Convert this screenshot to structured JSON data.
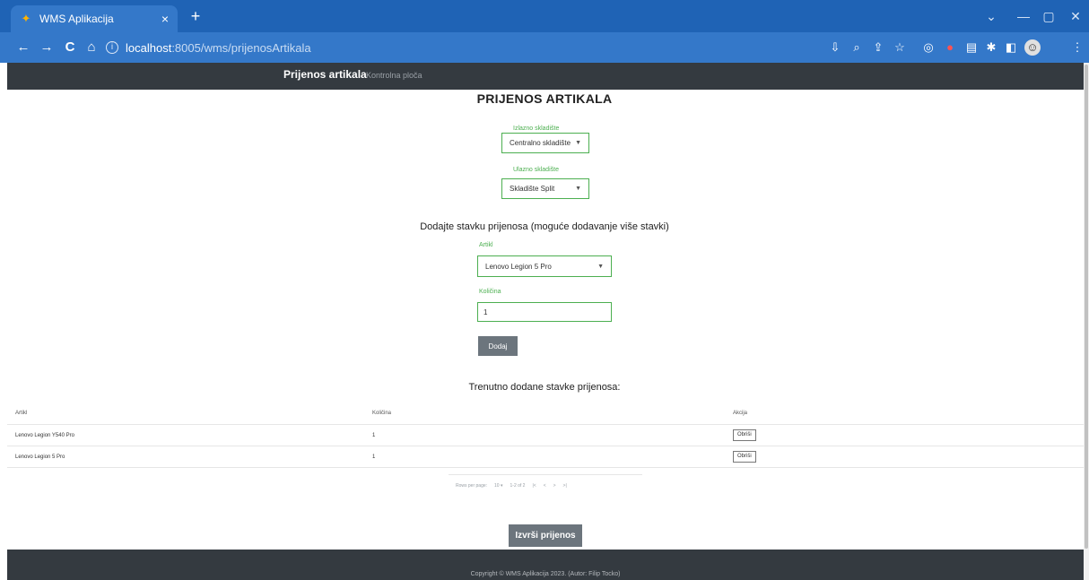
{
  "browser": {
    "tab_title": "WMS Aplikacija",
    "tab_close": "×",
    "new_tab": "+",
    "url_host": "localhost",
    "url_path": ":8005/wms/prijenosArtikala",
    "window_controls": {
      "minimize": "—",
      "restore": "▢",
      "close": "✕",
      "list": "⌄"
    },
    "nav": {
      "back": "←",
      "forward": "→",
      "reload": "C",
      "home": "⌂"
    }
  },
  "appnav": {
    "brand": "Prijenos artikala",
    "link": "Kontrolna ploča"
  },
  "page": {
    "title": "PRIJENOS ARTIKALA",
    "source_label": "Izlazno skladište",
    "source_value": "Centralno skladište",
    "dest_label": "Ulazno skladište",
    "dest_value": "Skladište Split",
    "add_heading": "Dodajte stavku prijenosa (moguće dodavanje više stavki)",
    "article_label": "Artikl",
    "article_value": "Lenovo Legion 5 Pro",
    "qty_label": "Količina",
    "qty_value": "1",
    "add_button": "Dodaj",
    "current_heading": "Trenutno dodane stavke prijenosa:",
    "execute_button": "Izvrši prijenos"
  },
  "table": {
    "headers": {
      "artikl": "Artikl",
      "kolicina": "Količina",
      "akcija": "Akcija"
    },
    "rows": [
      {
        "artikl": "Lenovo Legion Y540 Pro",
        "kolicina": "1",
        "action": "Obriši"
      },
      {
        "artikl": "Lenovo Legion 5 Pro",
        "kolicina": "1",
        "action": "Obriši"
      }
    ],
    "pagination": {
      "rows_per_page_label": "Rows per page:",
      "rows_per_page": "10",
      "range": "1-2 of 2",
      "first": "|<",
      "prev": "<",
      "next": ">",
      "last": ">|"
    }
  },
  "footer": {
    "copyright": "Copyright © WMS Aplikacija 2023. (Autor: Filip Tocko)"
  }
}
